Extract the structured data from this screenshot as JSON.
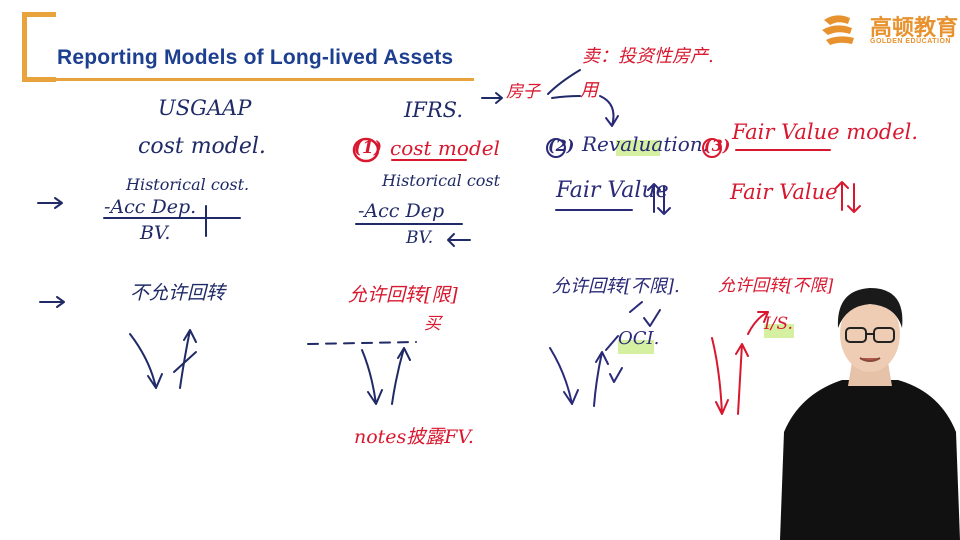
{
  "slide": {
    "title": "Reporting Models of Long-lived Assets"
  },
  "logo": {
    "name_cn": "高顿教育",
    "name_en": "GOLDEN EDUCATION"
  },
  "notes": {
    "usgaap": "USGAAP",
    "usgaap_model": "cost model.",
    "usgaap_hist": "Historical cost.",
    "usgaap_dep": "-Acc Dep.",
    "usgaap_bv": "BV.",
    "usgaap_reversal": "不允许回转",
    "ifrs": "IFRS.",
    "ifrs_num1": "(1)",
    "ifrs_model1": "cost model",
    "ifrs_hist": "Historical cost",
    "ifrs_dep": "-Acc Dep",
    "ifrs_bv": "BV.",
    "ifrs_reversal": "允许回转[限]",
    "ifrs_mark": "买",
    "ifrs_notes": "notes披露FV.",
    "house": "房子",
    "house_sell": "卖：投资性房产.",
    "house_use": "用",
    "num2": "(2)",
    "revaluation": "Revaluation.",
    "fair_value": "Fair Value",
    "reval_reversal": "允许回转[不限].",
    "oci": "OCI.",
    "num3": "(3)",
    "fv_model": "Fair Value model.",
    "fv_value": "Fair Value",
    "fv_reversal": "允许回转[不限]",
    "is": "I/S."
  },
  "colors": {
    "title_blue": "#1d3f8f",
    "accent_orange": "#e8a33d",
    "ink_navy": "#1f2a66",
    "ink_red": "#d8182f",
    "highlight_green": "#d4f0a0"
  }
}
